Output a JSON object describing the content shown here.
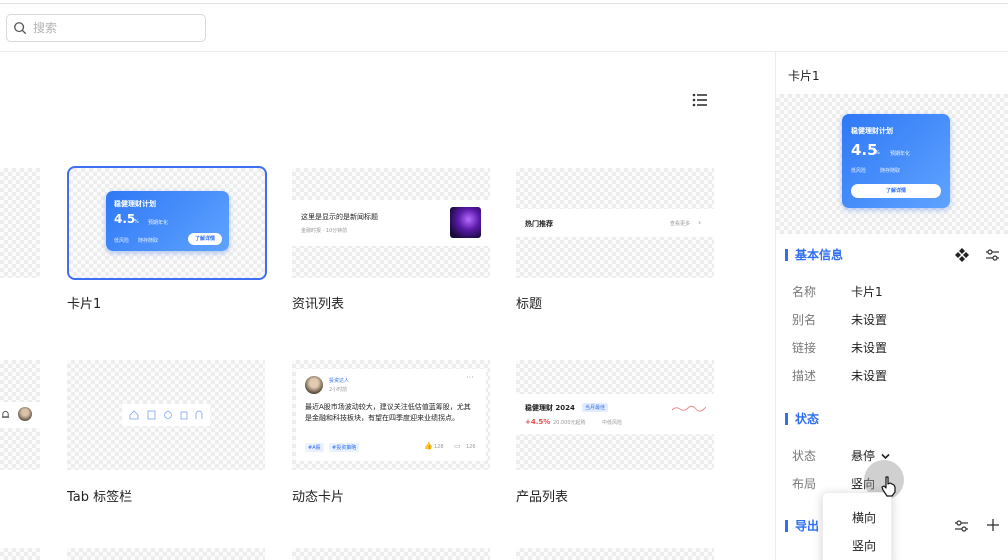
{
  "search": {
    "placeholder": "搜索"
  },
  "cards": [
    {
      "label": "卡片1"
    },
    {
      "label": "资讯列表"
    },
    {
      "label": "标题"
    },
    {
      "label": "Tab 标签栏"
    },
    {
      "label": "动态卡片"
    },
    {
      "label": "产品列表"
    }
  ],
  "finance_card": {
    "title": "稳健理财计划",
    "value": "4.5",
    "unit": "%",
    "tag": "预期年化",
    "risk": "低风险",
    "term": "随存随取",
    "button": "了解详情"
  },
  "news": {
    "title": "这里是显示的是新闻标题",
    "meta": "金融时报 · 10分钟前"
  },
  "heading": {
    "title": "热门推荐",
    "more": "查看更多"
  },
  "feed": {
    "author": "投资达人",
    "time": "2小时前",
    "text": "最近A股市场波动较大，建议关注低估值蓝筹股，尤其是金融和科技板块，有望在四季度迎来业绩拐点。",
    "tag1": "#A股",
    "tag2": "#投资策略",
    "likes": "128",
    "comments": "126"
  },
  "product": {
    "name": "稳健理财 2024",
    "badge": "当月最佳",
    "rate": "+4.5%",
    "info": "20,000元起购",
    "risk": "中低风险"
  },
  "panel": {
    "title": "卡片1",
    "basic_title": "基本信息",
    "props": [
      {
        "key": "名称",
        "value": "卡片1"
      },
      {
        "key": "别名",
        "value": "未设置"
      },
      {
        "key": "链接",
        "value": "未设置"
      },
      {
        "key": "描述",
        "value": "未设置"
      }
    ],
    "state_title": "状态",
    "state_key": "状态",
    "state_value": "悬停",
    "layout_key": "布局",
    "layout_value": "竖向",
    "export_title": "导出"
  },
  "dropdown": {
    "options": [
      "横向",
      "竖向"
    ]
  },
  "colors": {
    "accent": "#2f6ff3",
    "selected_border": "#3e6ff3"
  }
}
